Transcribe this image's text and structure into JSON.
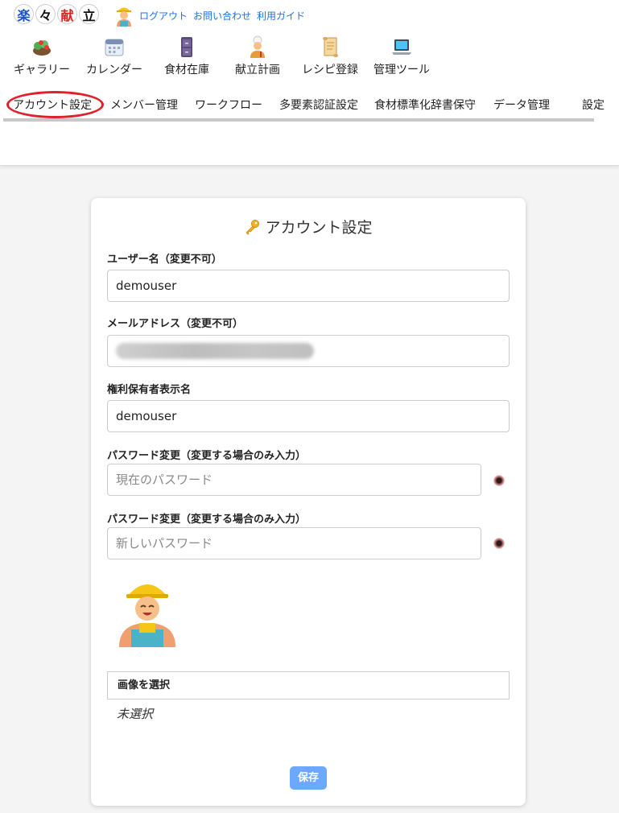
{
  "logo": {
    "chars": [
      "楽",
      "々",
      "献",
      "立"
    ],
    "colors": [
      "#1b4fd6",
      "#111111",
      "#e02020",
      "#111111"
    ]
  },
  "top_links": [
    "ログアウト",
    "お問い合わせ",
    "利用ガイド"
  ],
  "nav": [
    {
      "label": "ギャラリー",
      "icon": "salad-icon"
    },
    {
      "label": "カレンダー",
      "icon": "calendar-icon"
    },
    {
      "label": "食材在庫",
      "icon": "cabinet-icon"
    },
    {
      "label": "献立計画",
      "icon": "chef-icon"
    },
    {
      "label": "レシピ登録",
      "icon": "scroll-icon"
    },
    {
      "label": "管理ツール",
      "icon": "laptop-icon"
    }
  ],
  "tabs": [
    "アカウント設定",
    "メンバー管理",
    "ワークフロー",
    "多要素認証設定",
    "食材標準化辞書保守",
    "データ管理",
    "設定"
  ],
  "active_tab": "アカウント設定",
  "form": {
    "title": "アカウント設定",
    "username_label": "ユーザー名（変更不可）",
    "username_value": "demouser",
    "email_label": "メールアドレス（変更不可）",
    "display_name_label": "権利保有者表示名",
    "display_name_value": "demouser",
    "current_pw_label": "パスワード変更（変更する場合のみ入力）",
    "current_pw_placeholder": "現在のパスワード",
    "new_pw_label": "パスワード変更（変更する場合のみ入力）",
    "new_pw_placeholder": "新しいパスワード",
    "file_button": "画像を選択",
    "file_status": "未選択",
    "save_label": "保存"
  },
  "colors": {
    "link": "#1a73e8",
    "accent": "#6ea8fe",
    "highlight": "#e0202a"
  }
}
